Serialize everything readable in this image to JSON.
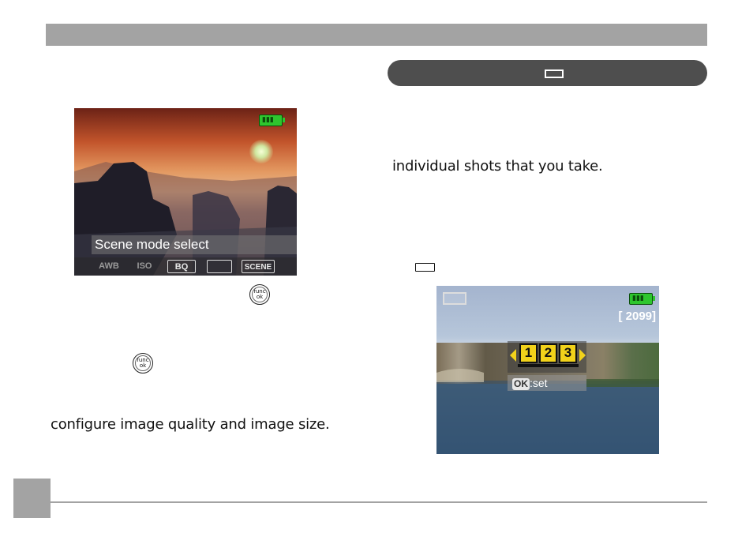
{
  "left_column": {
    "screen1": {
      "overlay_label": "Scene mode select",
      "toolbar": [
        "AWB",
        "ISO",
        "BQ",
        "",
        "SCENE"
      ]
    },
    "text_bottom": "configure image quality and image size."
  },
  "right_column": {
    "text_1": "individual shots that you take.",
    "screen2": {
      "counter": "[   2099]",
      "numbers": [
        "1",
        "2",
        "3"
      ],
      "ok_key": "OK",
      "ok_suffix": ":set"
    }
  },
  "colors": {
    "header_bar": "#a3a3a3",
    "pill": "#4e4e4e",
    "highlight": "#f2d21a",
    "battery": "#2ec62e"
  }
}
